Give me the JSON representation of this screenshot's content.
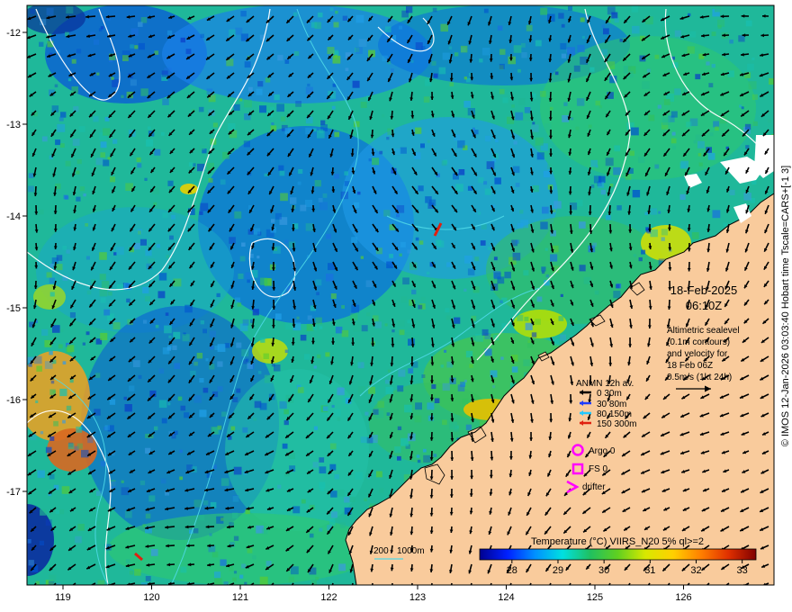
{
  "axes": {
    "x_ticks": [
      "119",
      "120",
      "121",
      "122",
      "123",
      "124",
      "125",
      "126"
    ],
    "y_ticks": [
      "-12",
      "-13",
      "-14",
      "-15",
      "-16",
      "-17"
    ]
  },
  "timestamp": {
    "date": "18-Feb-2025",
    "time": "06:10Z"
  },
  "altimetry_note": {
    "lines": [
      "Altimetric sealevel",
      "(0.1m contours)",
      "and velocity for",
      "18 Feb 06Z",
      "0.5m/s (1kt 24h)"
    ]
  },
  "anmn_legend": {
    "title": "ANMN 12h av.",
    "items": [
      {
        "label": "0 30m",
        "color": "#000000"
      },
      {
        "label": "30 80m",
        "color": "#1e3cff"
      },
      {
        "label": "80 150m",
        "color": "#22c8ff"
      },
      {
        "label": "150 300m",
        "color": "#e02010"
      }
    ]
  },
  "markers": [
    {
      "label": "Argo 0",
      "icon": "circle-icon",
      "color": "#ff00ff"
    },
    {
      "label": "FS 0",
      "icon": "square-icon",
      "color": "#ff00ff"
    },
    {
      "label": "drifter",
      "icon": "chevron-icon",
      "color": "#ff00ff"
    }
  ],
  "bathymetry_legend": {
    "labels": [
      "200",
      "1000m"
    ],
    "color": "#4fd9e8"
  },
  "colorbar": {
    "title": "Temperature (°C) VIIRS_N20 5% ql>=2",
    "ticks": [
      "28",
      "29",
      "30",
      "31",
      "32",
      "33"
    ],
    "range": [
      27.3,
      33.3
    ],
    "colors": [
      "#00008f",
      "#0020ff",
      "#0090ff",
      "#00e0e0",
      "#20c060",
      "#60d020",
      "#d8e800",
      "#ffd000",
      "#ff8000",
      "#e03000",
      "#800000"
    ]
  },
  "credit": "© IMOS 12-Jan-2026 03:03:40 Hobart time Tscale=CARS+[-1 3]"
}
